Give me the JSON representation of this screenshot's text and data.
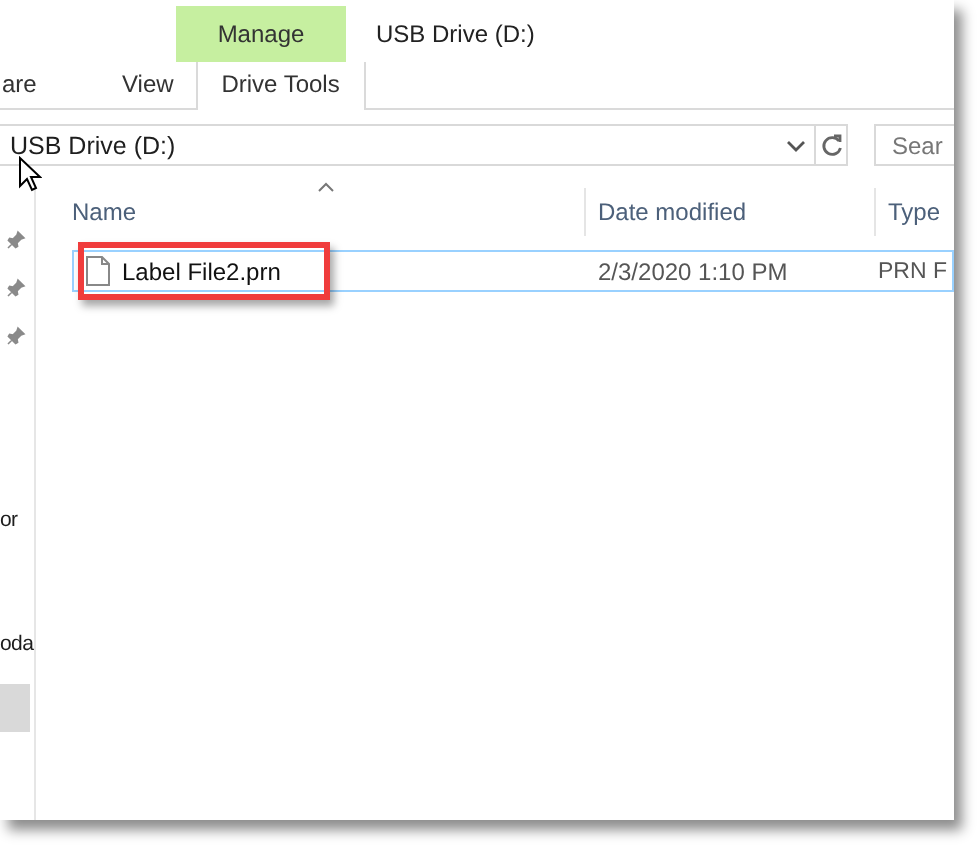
{
  "ribbon": {
    "contextual_tab": "Manage",
    "window_title": "USB Drive (D:)",
    "tabs": [
      {
        "label": "are",
        "selected": false
      },
      {
        "label": "View",
        "selected": false
      },
      {
        "label": "Drive Tools",
        "selected": true
      }
    ]
  },
  "address_bar": {
    "path": "USB Drive (D:)",
    "search_placeholder": "Sear"
  },
  "nav_pane": {
    "items": [
      {
        "kind": "pin",
        "selected": false
      },
      {
        "kind": "pin",
        "selected": false
      },
      {
        "kind": "pin",
        "selected": false
      },
      {
        "kind": "text",
        "label": "or",
        "selected": false
      },
      {
        "kind": "text",
        "label": "oda",
        "selected": false
      },
      {
        "kind": "blank",
        "selected": true
      }
    ]
  },
  "file_list": {
    "columns": [
      "Name",
      "Date modified",
      "Type"
    ],
    "rows": [
      {
        "name": "Label File2.prn",
        "date_modified": "2/3/2020 1:10 PM",
        "type": "PRN F",
        "selected": true,
        "highlighted": true
      }
    ]
  }
}
